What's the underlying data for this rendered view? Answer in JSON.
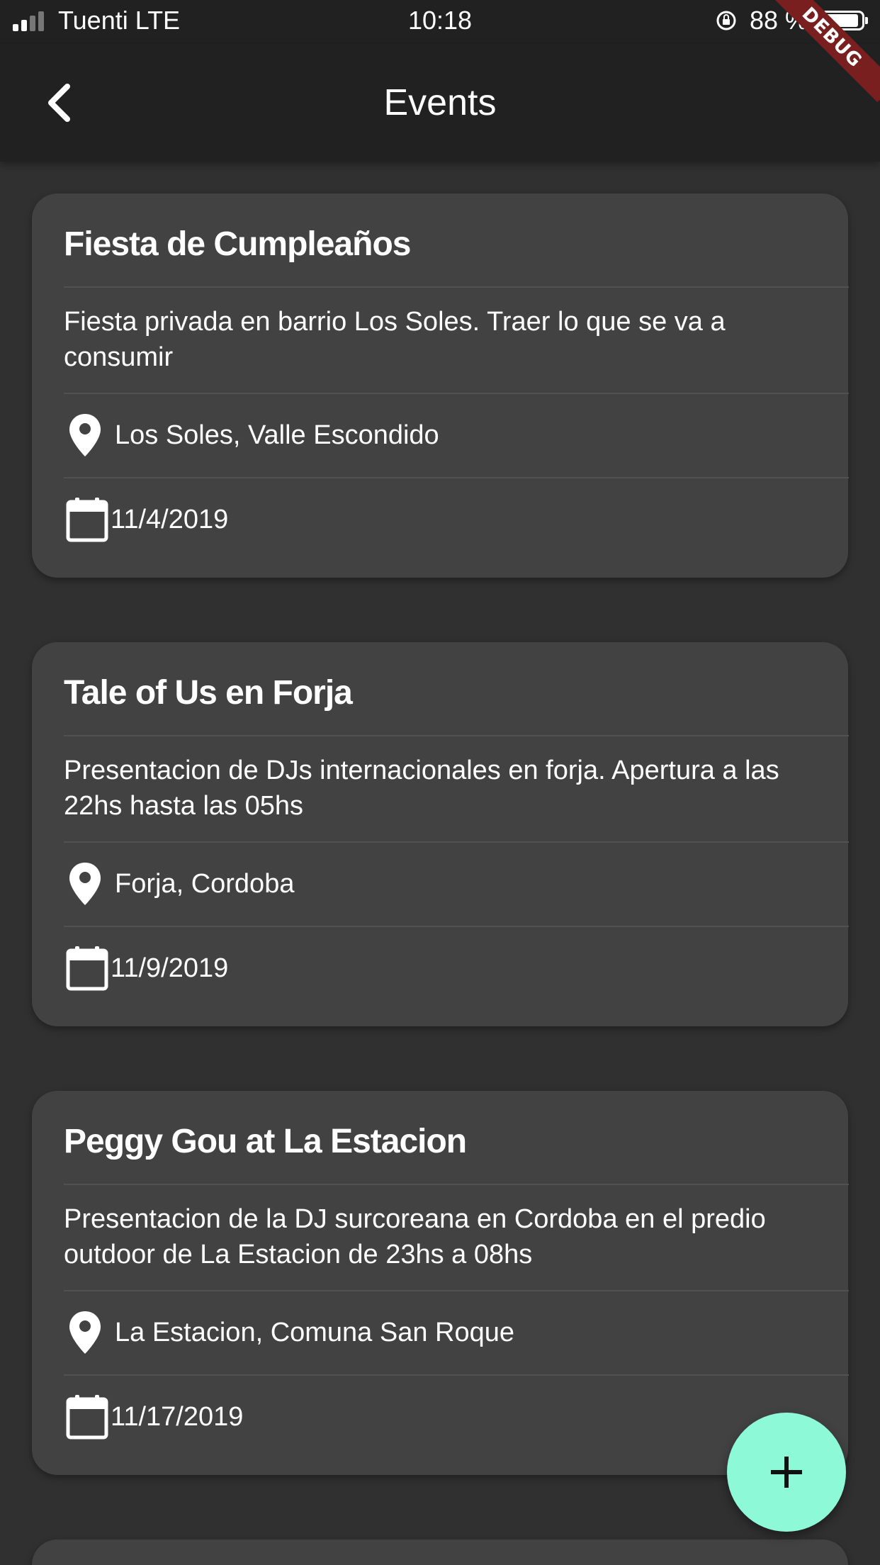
{
  "status_bar": {
    "carrier": "Tuenti  LTE",
    "time": "10:18",
    "battery": "88 %"
  },
  "debug_banner": "DEBUG",
  "app_bar": {
    "title": "Events",
    "back_icon": "chevron-left-icon"
  },
  "events": [
    {
      "title": "Fiesta de Cumpleaños",
      "description": "Fiesta privada en barrio Los Soles. Traer lo que se va a consumir",
      "location": "Los Soles, Valle Escondido",
      "date": "11/4/2019"
    },
    {
      "title": "Tale of Us en Forja",
      "description": "Presentacion de DJs internacionales en forja. Apertura a las 22hs hasta las 05hs",
      "location": "Forja, Cordoba",
      "date": "11/9/2019"
    },
    {
      "title": "Peggy Gou at La Estacion",
      "description": "Presentacion de la DJ surcoreana en Cordoba en el predio outdoor de La Estacion de 23hs a 08hs",
      "location": "La Estacion, Comuna San Roque",
      "date": "11/17/2019"
    }
  ],
  "fab": {
    "icon": "plus-icon",
    "color": "#8ef9d7"
  },
  "colors": {
    "background": "#303030",
    "app_bar": "#212121",
    "card": "#424242",
    "debug_banner": "#7a1f1f"
  }
}
